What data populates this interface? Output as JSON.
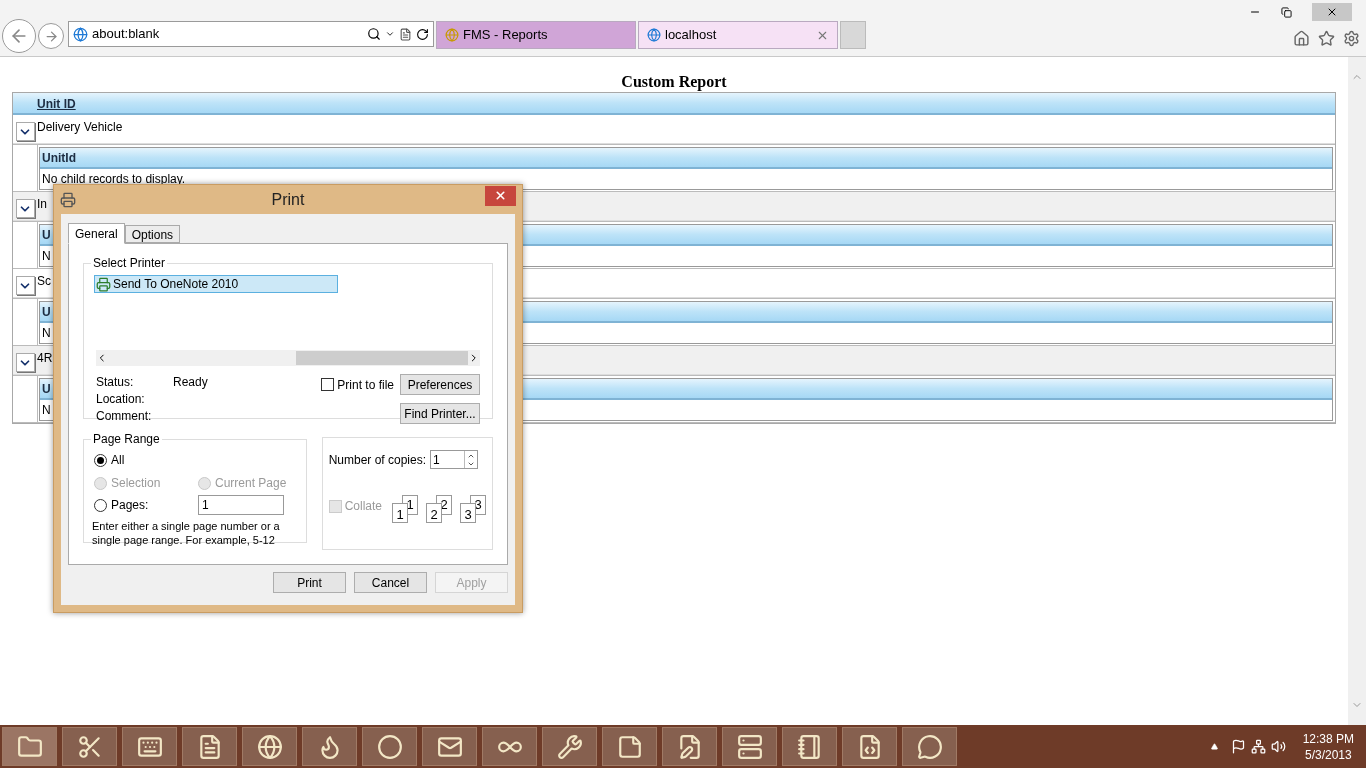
{
  "browser": {
    "address": "about:blank",
    "tabs": [
      {
        "label": "FMS - Reports",
        "selected": false
      },
      {
        "label": "localhost",
        "selected": true
      }
    ]
  },
  "report": {
    "title": "Custom Report",
    "column": "Unit ID",
    "rows": [
      {
        "text": "Delivery Vehicle",
        "expanded": true,
        "child_header": "UnitId",
        "child_text": "No child records to display."
      },
      {
        "text": "In",
        "expanded": true,
        "child_header": "U",
        "child_text": "N"
      },
      {
        "text": "Sc",
        "expanded": true,
        "child_header": "U",
        "child_text": "N"
      },
      {
        "text": "4R",
        "expanded": true,
        "child_header": "U",
        "child_text": "N"
      }
    ]
  },
  "dialog": {
    "title": "Print",
    "tabs": [
      {
        "label": "General",
        "selected": true
      },
      {
        "label": "Options",
        "selected": false
      }
    ],
    "printer_group": "Select Printer",
    "printers": [
      {
        "name": "Send To OneNote 2010",
        "selected": true
      }
    ],
    "info": [
      {
        "label": "Status:",
        "value": "Ready"
      },
      {
        "label": "Location:"
      },
      {
        "label": "Comment:"
      }
    ],
    "print_to_file": {
      "label": "Print to file",
      "checked": false
    },
    "preferences": "Preferences",
    "find_printer": "Find Printer...",
    "range_group": "Page Range",
    "ranges": [
      {
        "label": "All",
        "selected": true,
        "disabled": false
      },
      {
        "label": "Selection",
        "selected": false,
        "disabled": true
      },
      {
        "label": "Current Page",
        "selected": false,
        "disabled": true
      },
      {
        "label": "Pages:",
        "selected": false,
        "disabled": false
      }
    ],
    "pages_value": "1",
    "hint": "Enter either a single page number or a single page range.  For example, 5-12",
    "copies_label": "Number of copies:",
    "copies_value": "1",
    "collate": {
      "label": "Collate",
      "checked": false,
      "disabled": true
    },
    "collate_pages": [
      {
        "back": "1",
        "front": "1"
      },
      {
        "back": "2",
        "front": "2"
      },
      {
        "back": "3",
        "front": "3"
      }
    ],
    "buttons": [
      {
        "label": "Print",
        "disabled": false
      },
      {
        "label": "Cancel",
        "disabled": false
      },
      {
        "label": "Apply",
        "disabled": true
      }
    ]
  },
  "taskbar": {
    "time": "12:38 PM",
    "date": "5/3/2013"
  }
}
